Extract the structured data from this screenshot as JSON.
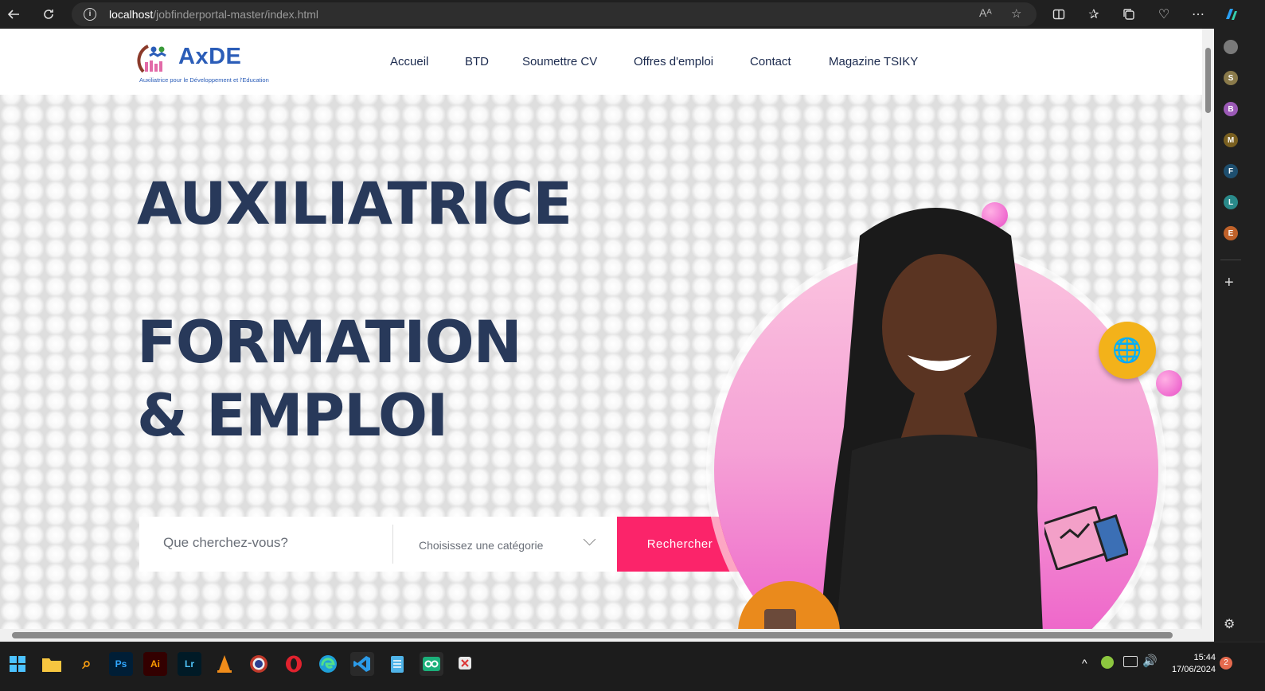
{
  "browser": {
    "url_host": "localhost",
    "url_path": "/jobfinderportal-master/index.html",
    "read_aloud": "Aᴬ"
  },
  "sidebar": {
    "profiles": [
      {
        "letter": "S",
        "color": "#8a7a4a"
      },
      {
        "letter": "B",
        "color": "#9b59b6"
      },
      {
        "letter": "M",
        "color": "#7a6020"
      },
      {
        "letter": "F",
        "color": "#1e4f6f"
      },
      {
        "letter": "L",
        "color": "#2a8a8a"
      },
      {
        "letter": "E",
        "color": "#c0622a"
      }
    ],
    "add": "+"
  },
  "site": {
    "logo": {
      "name": "AxDE",
      "tagline": "Auxiliatrice pour le Développement et l'Education"
    },
    "nav": [
      "Accueil",
      "BTD",
      "Soumettre CV",
      "Offres d'emploi",
      "Contact",
      "Magazine TSIKY"
    ],
    "hero": {
      "line1": "AUXILIATRICE",
      "line2": "FORMATION",
      "line3": "& EMPLOI"
    },
    "search": {
      "placeholder": "Que cherchez-vous?",
      "category": "Choisissez une catégorie",
      "button": "Rechercher"
    },
    "accent_color": "#fb246a"
  },
  "taskbar": {
    "apps": [
      {
        "label": "Ps",
        "color": "#001e36",
        "fg": "#31a8ff"
      },
      {
        "label": "Ai",
        "color": "#330000",
        "fg": "#ff9a00"
      },
      {
        "label": "Lr",
        "color": "#001a26",
        "fg": "#4fc3f7"
      }
    ],
    "time": "15:44",
    "date": "17/06/2024",
    "notifications": "2"
  }
}
